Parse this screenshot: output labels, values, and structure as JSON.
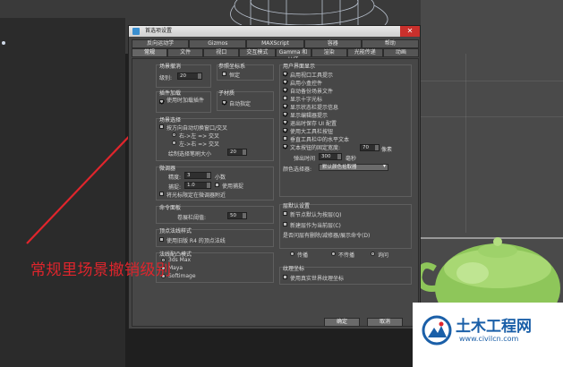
{
  "dialog": {
    "title": "首选项设置",
    "close_glyph": "✕",
    "tabs_row1": [
      "反向运动学",
      "Gizmos",
      "MAXScript",
      "容器",
      "帮助"
    ],
    "tabs_row2": [
      "常规",
      "文件",
      "视口",
      "交互模式",
      "Gamma 和 LUT",
      "渲染",
      "光能传递",
      "动画"
    ],
    "active_tab": "常规",
    "scene_undo": {
      "title": "场景撤消",
      "levels_label": "级别:",
      "levels_value": "20"
    },
    "reference_coord": {
      "title": "参照坐标系",
      "constant_label": "恒定"
    },
    "plugin_loading": {
      "title": "插件加载",
      "deferred_label": "使用时加载插件"
    },
    "sub_material": {
      "title": "子材质",
      "auto_assign_label": "自动指定"
    },
    "scene_selection": {
      "title": "场景选择",
      "auto_window_label": "按方向自动切换窗口/交叉",
      "right_to_left_label": "右->左 => 交叉",
      "left_to_right_label": "左->右 => 交叉",
      "paint_brush_label": "绘制选择笔刷大小",
      "paint_brush_value": "20"
    },
    "spinners": {
      "title": "微调器",
      "precision_label": "精度:",
      "precision_value": "3",
      "decimals_label": "小数",
      "snap_label": "捕捉:",
      "snap_value": "1.0",
      "use_snap_label": "使用捕捉",
      "wrap_cursor_label": "将光标限定在微调器附近"
    },
    "command_panel": {
      "title": "命令面板",
      "rollout_threshold_label": "卷展栏阈值:",
      "rollout_threshold_value": "50"
    },
    "vertex_normal": {
      "title": "顶点法线样式",
      "legacy_label": "使用旧版 R4 的顶点法线"
    },
    "joint_ik": {
      "title": "法线配凸模式",
      "option_1": "3ds Max",
      "option_2": "Maya",
      "option_3": "Softimage"
    },
    "ui_display": {
      "title": "用户界面显示",
      "options": [
        {
          "label": "启用视口工具提示",
          "checked": true
        },
        {
          "label": "启用小盒控件",
          "checked": true
        },
        {
          "label": "自动备份场景文件",
          "checked": true
        },
        {
          "label": "显示十字光标",
          "checked": false
        },
        {
          "label": "显示状态栏提示信息",
          "checked": true
        },
        {
          "label": "显示编辑器提示",
          "checked": true
        },
        {
          "label": "退出时保存 UI 配置",
          "checked": true
        },
        {
          "label": "使用大工具栏按钮",
          "checked": true
        },
        {
          "label": "垂直工具栏中的水平文本",
          "checked": false
        },
        {
          "label": "文本按钮的固定宽度:",
          "checked": true
        }
      ],
      "fixed_width_value": "70",
      "fixed_width_unit": "像素",
      "flyout_time_label": "弹出时间",
      "flyout_time_value": "300",
      "flyout_time_unit": "毫秒",
      "color_selector_label": "颜色选择器:",
      "color_selector_value": "默认颜色拾取器"
    },
    "layer_defaults": {
      "title": "层默认设置",
      "new_by_layer_label": "新节点默认为按层(Q)",
      "new_layer_current_label": "新建层作为当前层(C)",
      "ask_on_delete_label": "是否问层有删除/减修器/展示命令(D)"
    },
    "tristate": {
      "option_1": "传播",
      "option_2": "不传播",
      "option_3": "询问"
    },
    "real_world": {
      "title": "纹理坐标",
      "use_real_world_label": "使用真实世界纹理坐标"
    },
    "buttons": {
      "ok": "确定",
      "cancel": "取消"
    }
  },
  "caption": "常规里场景撤销级别",
  "watermark": {
    "name": "土木工程网",
    "url": "www.civilcn.com"
  },
  "colors": {
    "caption": "#e0252c",
    "arrow": "#e0252c",
    "teapot": "#9ed26a",
    "watermark_blue": "#1a5fa8"
  }
}
